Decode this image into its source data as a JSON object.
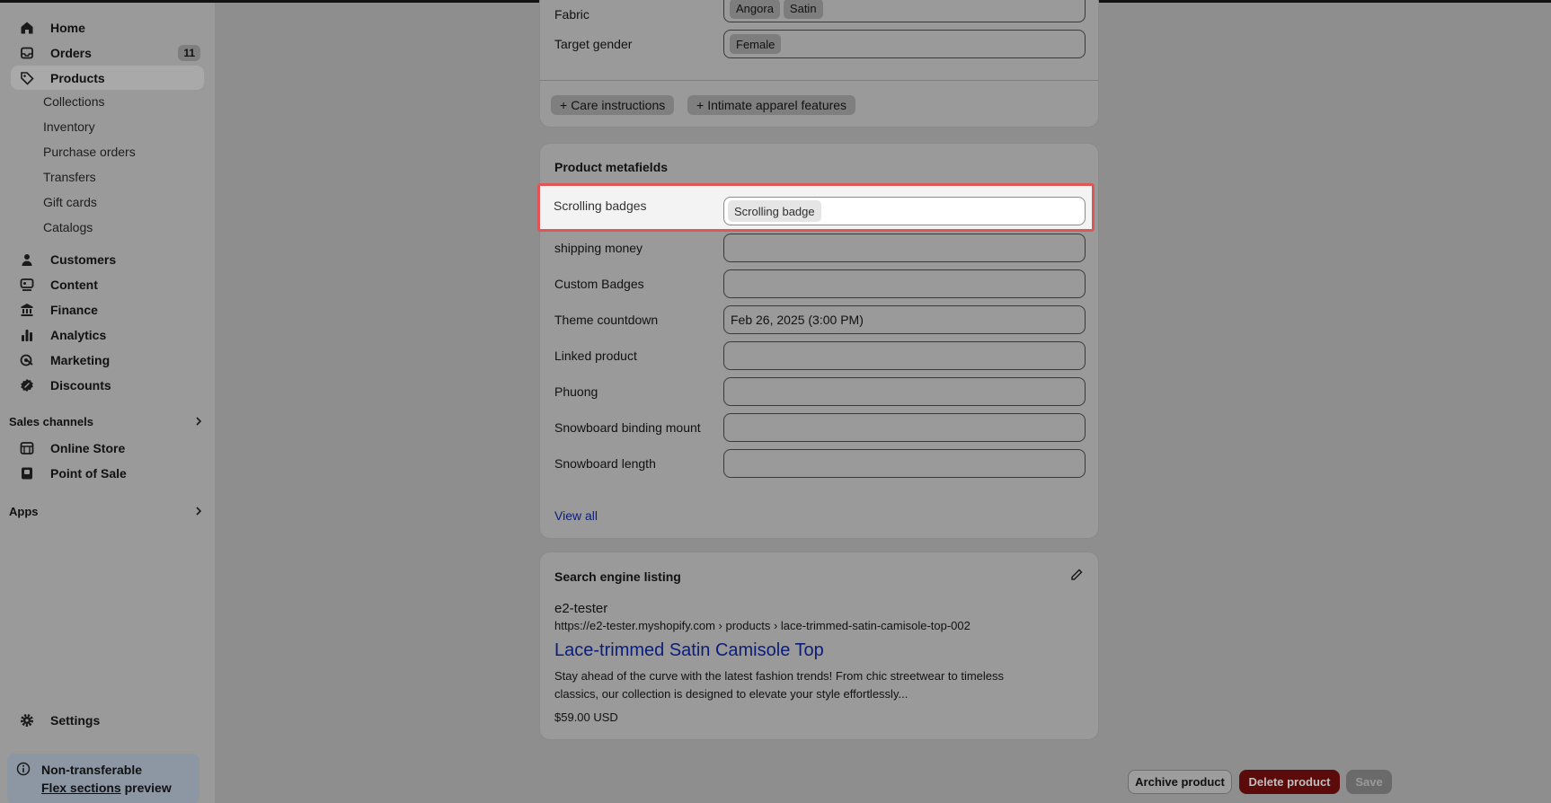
{
  "sidebar": {
    "items": [
      {
        "label": "Home",
        "icon": "home-icon"
      },
      {
        "label": "Orders",
        "icon": "inbox-icon",
        "count": "11"
      },
      {
        "label": "Products",
        "icon": "tag-icon"
      },
      {
        "label": "Customers",
        "icon": "person-icon"
      },
      {
        "label": "Content",
        "icon": "content-icon"
      },
      {
        "label": "Finance",
        "icon": "bank-icon"
      },
      {
        "label": "Analytics",
        "icon": "bar-chart-icon"
      },
      {
        "label": "Marketing",
        "icon": "target-icon"
      },
      {
        "label": "Discounts",
        "icon": "discount-icon"
      }
    ],
    "product_subitems": [
      "Collections",
      "Inventory",
      "Purchase orders",
      "Transfers",
      "Gift cards",
      "Catalogs"
    ],
    "sales_channels_label": "Sales channels",
    "channels": [
      {
        "label": "Online Store",
        "icon": "store-icon"
      },
      {
        "label": "Point of Sale",
        "icon": "pos-icon"
      }
    ],
    "apps_label": "Apps",
    "settings_label": "Settings",
    "preview": {
      "line1": "Non-transferable",
      "link": "Flex sections",
      "suffix": " preview"
    }
  },
  "category_card": {
    "fabric_label": "Fabric",
    "fabric_tags": [
      "Angora",
      "Satin"
    ],
    "gender_label": "Target gender",
    "gender_tags": [
      "Female"
    ],
    "add_buttons": [
      "Care instructions",
      "Intimate apparel features"
    ]
  },
  "metafields": {
    "title": "Product metafields",
    "highlight": {
      "label": "Scrolling badges",
      "tag": "Scrolling badge"
    },
    "rows": [
      {
        "label": "shipping money",
        "value": ""
      },
      {
        "label": "Custom Badges",
        "value": ""
      },
      {
        "label": "Theme countdown",
        "value": "Feb 26, 2025 (3:00 PM)"
      },
      {
        "label": "Linked product",
        "value": ""
      },
      {
        "label": "Phuong",
        "value": ""
      },
      {
        "label": "Snowboard binding mount",
        "value": ""
      },
      {
        "label": "Snowboard length",
        "value": ""
      }
    ],
    "view_all": "View all"
  },
  "seo": {
    "title": "Search engine listing",
    "store": "e2-tester",
    "url": "https://e2-tester.myshopify.com › products › lace-trimmed-satin-camisole-top-002",
    "page_title": "Lace-trimmed Satin Camisole Top",
    "desc_line1": "Stay ahead of the curve with the latest fashion trends! From chic streetwear to timeless",
    "desc_line2": "classics, our collection is designed to elevate your style effortlessly...",
    "price": "$59.00 USD"
  },
  "footer": {
    "archive": "Archive product",
    "delete": "Delete product",
    "save": "Save"
  },
  "colors": {
    "highlight_border": "#e05555",
    "delete_bg": "#5c0b0b",
    "link": "#0b1d7a"
  }
}
